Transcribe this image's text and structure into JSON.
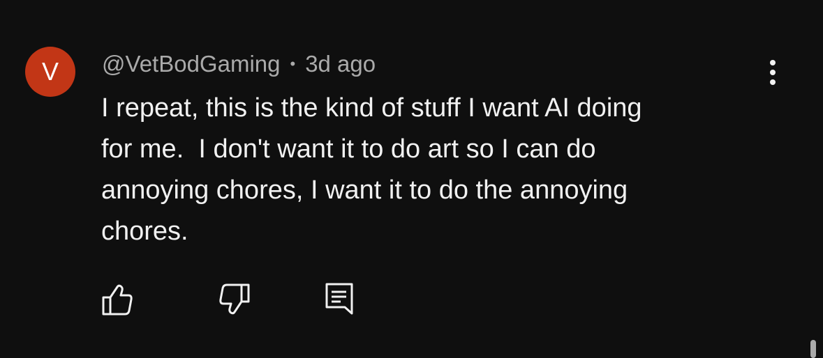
{
  "comment": {
    "avatar_letter": "V",
    "avatar_color": "#c23616",
    "author": "@VetBodGaming",
    "separator": "•",
    "timestamp": "3d ago",
    "text": "I repeat, this is the kind of stuff I want AI doing\nfor me.  I don't want it to do art so I can do\nannoying chores, I want it to do the annoying\nchores."
  },
  "actions": {
    "like_icon": "thumbs-up-icon",
    "dislike_icon": "thumbs-down-icon",
    "reply_icon": "reply-icon",
    "more_icon": "more-vertical-icon"
  },
  "colors": {
    "background": "#0f0f0f",
    "primary_text": "#f1f1f1",
    "secondary_text": "#aaaaaa"
  }
}
